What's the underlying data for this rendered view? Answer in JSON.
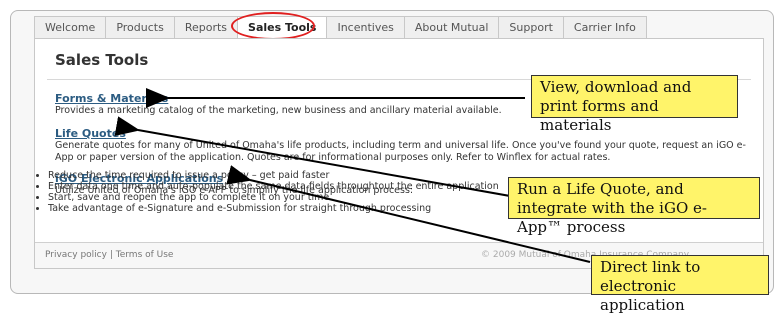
{
  "tabs": [
    {
      "label": "Welcome"
    },
    {
      "label": "Products"
    },
    {
      "label": "Reports"
    },
    {
      "label": "Sales Tools"
    },
    {
      "label": "Incentives"
    },
    {
      "label": "About Mutual"
    },
    {
      "label": "Support"
    },
    {
      "label": "Carrier Info"
    }
  ],
  "active_tab": "Sales Tools",
  "page_title": "Sales Tools",
  "sections": [
    {
      "title": "Forms & Materials",
      "body": "Provides a marketing catalog of the marketing, new business and ancillary material available."
    },
    {
      "title": "Life Quotes",
      "body": "Generate quotes for many of United of Omaha's life products, including term and universal life. Once you've found your quote, request an iGO e-App or paper version of the application. Quotes are for informational purposes only. Refer to Winflex for actual rates."
    },
    {
      "title": "iGO Electronic Applications",
      "body": "Utilize United of Omaha's iGO e-APP to simplify the life application process:",
      "bullets": [
        "Reduce the time required to issue a policy – get paid faster",
        "Enter data one time and auto-populate the same data fields throughtout the entire application",
        "Start, save and reopen the app to complete it on your time",
        "Take advantage of e-Signature and e-Submission for straight through processing"
      ]
    }
  ],
  "footer": {
    "privacy": "Privacy policy",
    "separator": "|",
    "terms": "Terms of Use",
    "copyright": "© 2009 Mutual of Omaha Insurance Company"
  },
  "callouts": {
    "forms": "View, download and print forms and materials",
    "quote": "Run a Life Quote, and integrate with the iGO e-App™ process",
    "direct": "Direct link to electronic application"
  },
  "colors": {
    "callout_fill": "#fff46a",
    "highlight_ring": "#e02020",
    "link_blue": "#2c5c82"
  }
}
